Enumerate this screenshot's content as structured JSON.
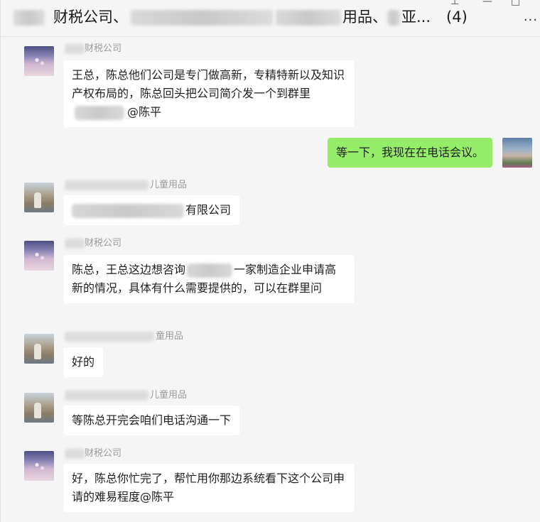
{
  "window": {
    "title_part1": "财税公司、",
    "title_part2": "用品、",
    "title_part3": "亚...",
    "member_count": "(4)",
    "more_icon": "···"
  },
  "messages": [
    {
      "sender": "财税公司",
      "avatar": "avatar-a",
      "text_a": "王总，陈总他们公司是专门做高新，专精特新以及知识产权布局的，陈总回头把公司简介发一个到群里",
      "text_b": "@陈平"
    },
    {
      "sender": "",
      "avatar": "avatar-me",
      "text_a": "等一下，我现在在电话会议。"
    },
    {
      "sender": "儿童用品",
      "avatar": "avatar-b",
      "text_a": "有限公司"
    },
    {
      "sender": "财税公司",
      "avatar": "avatar-a",
      "text_a": "陈总，王总这边想咨询",
      "text_b": "一家制造企业申请高新的情况，具体有什么需要提供的，可以在群里问"
    },
    {
      "sender": "童用品",
      "avatar": "avatar-b",
      "text_a": "好的"
    },
    {
      "sender": "儿童用品",
      "avatar": "avatar-b",
      "text_a": "等陈总开完会咱们电话沟通一下"
    },
    {
      "sender": "财税公司",
      "avatar": "avatar-a",
      "text_a": "好，陈总你忙完了，帮忙用你那边系统看下这个公司申请的难易程度@陈平"
    }
  ]
}
